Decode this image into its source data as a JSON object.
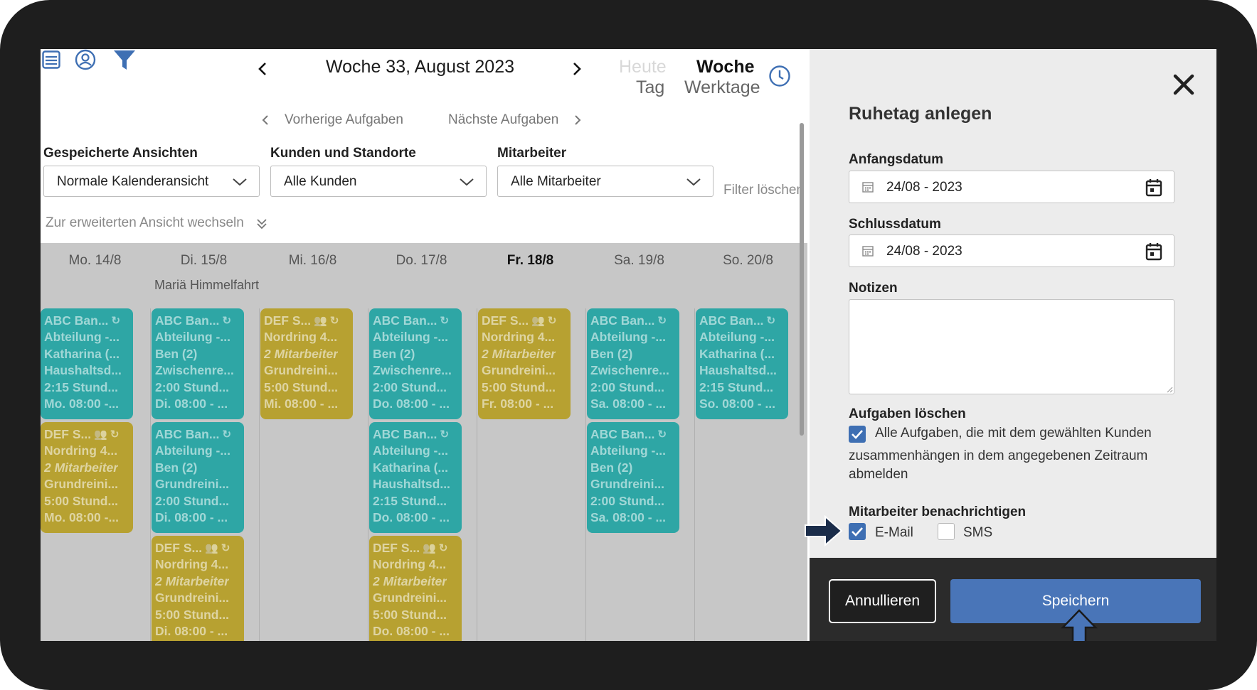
{
  "topbar": {
    "title": "Woche 33, August 2023",
    "views": {
      "heute": "Heute",
      "tag": "Tag",
      "woche": "Woche",
      "werktage": "Werktage"
    }
  },
  "task_nav": {
    "prev": "Vorherige Aufgaben",
    "next": "Nächste Aufgaben"
  },
  "filters": {
    "saved_views_label": "Gespeicherte Ansichten",
    "saved_views_value": "Normale Kalenderansicht",
    "customers_label": "Kunden und Standorte",
    "customers_value": "Alle Kunden",
    "employees_label": "Mitarbeiter",
    "employees_value": "Alle Mitarbeiter",
    "clear": "Filter löschen",
    "advanced_toggle": "Zur erweiterten Ansicht wechseln"
  },
  "calendar": {
    "days": [
      {
        "label": "Mo. 14/8",
        "holiday": ""
      },
      {
        "label": "Di. 15/8",
        "holiday": "Mariä Himmelfahrt"
      },
      {
        "label": "Mi. 16/8",
        "holiday": ""
      },
      {
        "label": "Do. 17/8",
        "holiday": ""
      },
      {
        "label": "Fr. 18/8",
        "holiday": ""
      },
      {
        "label": "Sa. 19/8",
        "holiday": ""
      },
      {
        "label": "So. 20/8",
        "holiday": ""
      }
    ],
    "cards": [
      [
        {
          "color": "teal",
          "lines": [
            "ABC Ban...",
            "Abteilung -...",
            "Katharina (...",
            "Haushaltsd...",
            "2:15 Stund...",
            "Mo. 08:00 -..."
          ]
        },
        {
          "color": "gold",
          "lines": [
            "DEF S...",
            "Nordring 4...",
            "2 Mitarbeiter",
            "Grundreini...",
            "5:00 Stund...",
            "Mo. 08:00 -..."
          ]
        }
      ],
      [
        {
          "color": "teal",
          "lines": [
            "ABC Ban...",
            "Abteilung -...",
            "Ben (2)",
            "Zwischenre...",
            "2:00 Stund...",
            "Di. 08:00 - ..."
          ]
        },
        {
          "color": "teal",
          "lines": [
            "ABC Ban...",
            "Abteilung -...",
            "Ben (2)",
            "Grundreini...",
            "2:00 Stund...",
            "Di. 08:00 - ..."
          ]
        },
        {
          "color": "gold",
          "lines": [
            "DEF S...",
            "Nordring 4...",
            "2 Mitarbeiter",
            "Grundreini...",
            "5:00 Stund...",
            "Di. 08:00 - ..."
          ]
        }
      ],
      [
        {
          "color": "gold",
          "lines": [
            "DEF S...",
            "Nordring 4...",
            "2 Mitarbeiter",
            "Grundreini...",
            "5:00 Stund...",
            "Mi. 08:00 - ..."
          ]
        }
      ],
      [
        {
          "color": "teal",
          "lines": [
            "ABC Ban...",
            "Abteilung -...",
            "Ben (2)",
            "Zwischenre...",
            "2:00 Stund...",
            "Do. 08:00 - ..."
          ]
        },
        {
          "color": "teal",
          "lines": [
            "ABC Ban...",
            "Abteilung -...",
            "Katharina (...",
            "Haushaltsd...",
            "2:15 Stund...",
            "Do. 08:00 - ..."
          ]
        },
        {
          "color": "gold",
          "lines": [
            "DEF S...",
            "Nordring 4...",
            "2 Mitarbeiter",
            "Grundreini...",
            "5:00 Stund...",
            "Do. 08:00 - ..."
          ]
        }
      ],
      [
        {
          "color": "gold",
          "lines": [
            "DEF S...",
            "Nordring 4...",
            "2 Mitarbeiter",
            "Grundreini...",
            "5:00 Stund...",
            "Fr. 08:00 - ..."
          ]
        }
      ],
      [
        {
          "color": "teal",
          "lines": [
            "ABC Ban...",
            "Abteilung -...",
            "Ben (2)",
            "Zwischenre...",
            "2:00 Stund...",
            "Sa. 08:00 - ..."
          ]
        },
        {
          "color": "teal",
          "lines": [
            "ABC Ban...",
            "Abteilung -...",
            "Ben (2)",
            "Grundreini...",
            "2:00 Stund...",
            "Sa. 08:00 - ..."
          ]
        }
      ],
      [
        {
          "color": "teal",
          "lines": [
            "ABC Ban...",
            "Abteilung -...",
            "Katharina (...",
            "Haushaltsd...",
            "2:15 Stund...",
            "So. 08:00 - ..."
          ]
        }
      ]
    ]
  },
  "panel": {
    "title": "Ruhetag anlegen",
    "start_label": "Anfangsdatum",
    "start_value": "24/08 - 2023",
    "end_label": "Schlussdatum",
    "end_value": "24/08 - 2023",
    "notes_label": "Notizen",
    "notes_value": "",
    "delete_label": "Aufgaben löschen",
    "delete_line1": "Alle Aufgaben, die mit dem gewählten Kunden",
    "delete_line2": "zusammenhängen in dem angegebenen Zeitraum",
    "delete_line3": "abmelden",
    "notify_label": "Mitarbeiter benachrichtigen",
    "email": "E-Mail",
    "sms": "SMS",
    "cancel": "Annullieren",
    "save": "Speichern"
  },
  "colors": {
    "teal": "#2ea6a5",
    "gold": "#b7a131",
    "accent": "#3e6fb3",
    "save": "#4975b8"
  },
  "icons": [
    "list-icon",
    "user-circle-icon",
    "filter-icon",
    "chevron-left-icon",
    "chevron-right-icon",
    "clock-icon",
    "close-icon",
    "calendar-icon",
    "double-chevron-down-icon",
    "repeat-icon",
    "group-icon",
    "arrow-right-icon",
    "arrow-up-icon"
  ]
}
